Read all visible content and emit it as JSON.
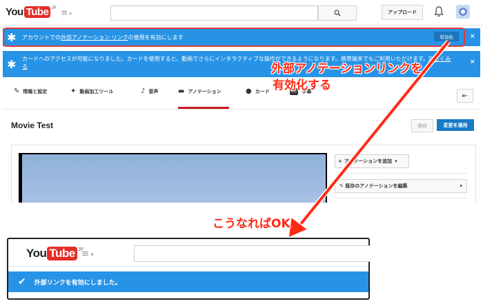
{
  "header": {
    "logo_you": "You",
    "logo_tube": "Tube",
    "logo_region": "JP",
    "guide_icon": "≡",
    "search_icon": "search-icon",
    "upload_label": "アップロード",
    "bell_icon": "bell-icon"
  },
  "banner_external_links": {
    "icon": "✱",
    "text_prefix": "アカウントでの",
    "text_link": "外部アノテーション リンク",
    "text_suffix": "の使用を有効にします",
    "enable_label": "有効化",
    "close": "×"
  },
  "banner_cards": {
    "icon": "✱",
    "text": "カードへのアクセスが可能になりました。カードを使用すると、動画でさらにインタラクティブな操作ができるようになります。携帯端末でもご利用いただけます。",
    "link": "詳しくみる",
    "close": "×"
  },
  "tabs": [
    {
      "icon": "✎",
      "label": "情報と設定"
    },
    {
      "icon": "✦",
      "label": "動画加工ツール"
    },
    {
      "icon": "♪",
      "label": "音声"
    },
    {
      "icon": "▬",
      "label": "アノテーション"
    },
    {
      "icon": "●",
      "label": "カード"
    },
    {
      "icon": "CC",
      "label": "字幕"
    }
  ],
  "back_icon": "⇤",
  "video": {
    "title": "Movie Test",
    "save_label": "保存",
    "apply_label": "変更を適用"
  },
  "annotations": {
    "add_label": "アノテーションを追加",
    "edit_label": "既存のアノテーションを編集"
  },
  "callouts": {
    "instruction_line1": "外部アノテーションリンクを",
    "instruction_line2": "有効化する",
    "result": "こうなればOK"
  },
  "inset": {
    "logo_you": "You",
    "logo_tube": "Tube",
    "logo_region": "JP",
    "guide_icon": "≡",
    "success_message": "外部リンクを有効にしました。",
    "check_icon": "✔"
  },
  "colors": {
    "banner_blue": "#2793e6",
    "arrow_red": "#ff2a14",
    "youtube_red": "#e52d27",
    "apply_blue": "#167ac6"
  }
}
